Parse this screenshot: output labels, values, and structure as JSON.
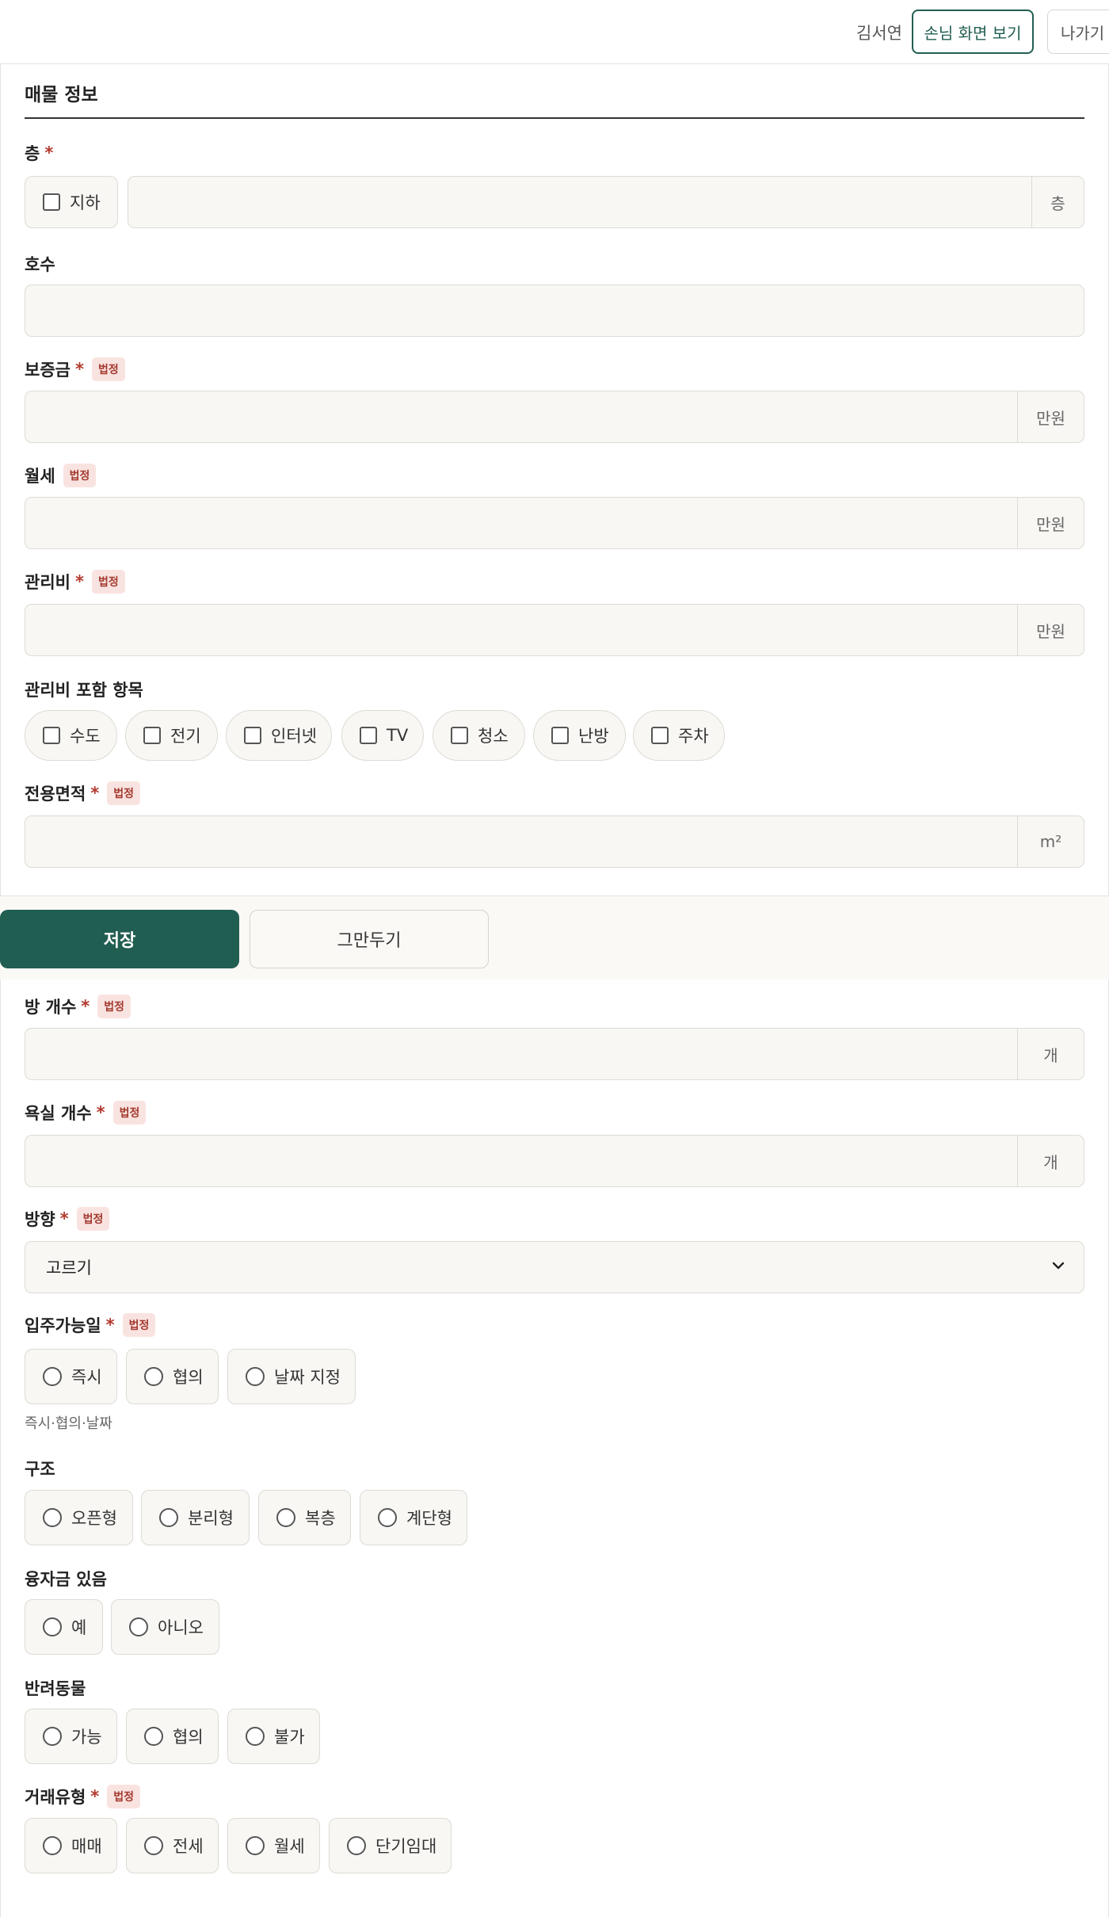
{
  "header": {
    "user_name": "김서연",
    "guest_view_label": "손님 화면 보기",
    "exit_label": "나가기"
  },
  "section": {
    "title": "매물 정보"
  },
  "badge_text": "법정",
  "required_mark": "*",
  "fields": {
    "floor": {
      "label": "층",
      "basement_label": "지하",
      "suffix": "층",
      "value": ""
    },
    "unit_no": {
      "label": "호수",
      "value": ""
    },
    "deposit": {
      "label": "보증금",
      "suffix": "만원",
      "value": ""
    },
    "monthly_rent": {
      "label": "월세",
      "suffix": "만원",
      "value": ""
    },
    "maintenance_fee": {
      "label": "관리비",
      "suffix": "만원",
      "value": ""
    },
    "maintenance_includes": {
      "label": "관리비 포함 항목",
      "options": [
        "수도",
        "전기",
        "인터넷",
        "TV",
        "청소",
        "난방",
        "주차"
      ]
    },
    "exclusive_area": {
      "label": "전용면적",
      "suffix": "m²",
      "value": ""
    },
    "room_count": {
      "label": "방 개수",
      "suffix": "개",
      "value": ""
    },
    "bathroom_count": {
      "label": "욕실 개수",
      "suffix": "개",
      "value": ""
    },
    "direction": {
      "label": "방향",
      "selected": "고르기"
    },
    "move_in": {
      "label": "입주가능일",
      "options": [
        "즉시",
        "협의",
        "날짜 지정"
      ],
      "hint": "즉시·협의·날짜"
    },
    "structure": {
      "label": "구조",
      "options": [
        "오픈형",
        "분리형",
        "복층",
        "계단형"
      ]
    },
    "loan": {
      "label": "융자금 있음",
      "options": [
        "예",
        "아니오"
      ]
    },
    "pets": {
      "label": "반려동물",
      "options": [
        "가능",
        "협의",
        "불가"
      ]
    },
    "deal_type": {
      "label": "거래유형",
      "options": [
        "매매",
        "전세",
        "월세",
        "단기임대"
      ]
    }
  },
  "actions": {
    "save_label": "저장",
    "cancel_label": "그만두기"
  }
}
